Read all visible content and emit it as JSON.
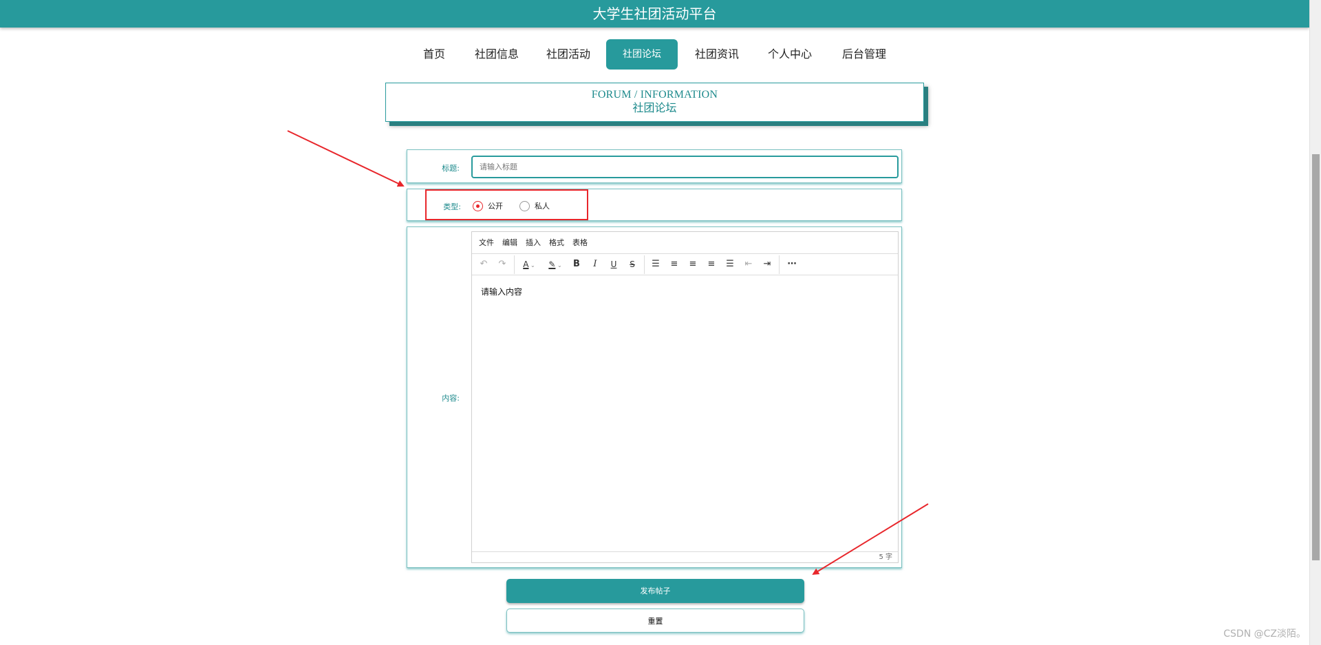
{
  "app": {
    "title": "大学生社团活动平台"
  },
  "nav": {
    "items": [
      {
        "label": "首页",
        "active": false
      },
      {
        "label": "社团信息",
        "active": false
      },
      {
        "label": "社团活动",
        "active": false
      },
      {
        "label": "社团论坛",
        "active": true
      },
      {
        "label": "社团资讯",
        "active": false
      },
      {
        "label": "个人中心",
        "active": false
      },
      {
        "label": "后台管理",
        "active": false
      }
    ]
  },
  "header": {
    "en": "FORUM / INFORMATION",
    "cn": "社团论坛"
  },
  "form": {
    "title_label": "标题:",
    "title_placeholder": "请输入标题",
    "type_label": "类型:",
    "type_options": [
      {
        "label": "公开",
        "checked": true
      },
      {
        "label": "私人",
        "checked": false
      }
    ],
    "content_label": "内容:",
    "editor": {
      "menu": [
        "文件",
        "编辑",
        "插入",
        "格式",
        "表格"
      ],
      "toolbar_icons": [
        "undo-icon",
        "redo-icon",
        "text-color-icon",
        "highlight-color-icon",
        "bold-icon",
        "italic-icon",
        "underline-icon",
        "strikethrough-icon",
        "list-icon",
        "align-left-icon",
        "align-center-icon",
        "align-right-icon",
        "align-justify-icon",
        "outdent-icon",
        "indent-icon",
        "more-icon"
      ],
      "body_text": "请输入内容",
      "word_count": "5 字"
    }
  },
  "buttons": {
    "submit": "发布帖子",
    "reset": "重置"
  },
  "watermark": "CSDN @CZ淡陌。",
  "colors": {
    "primary": "#279a9c",
    "annotation": "#e8262b"
  }
}
